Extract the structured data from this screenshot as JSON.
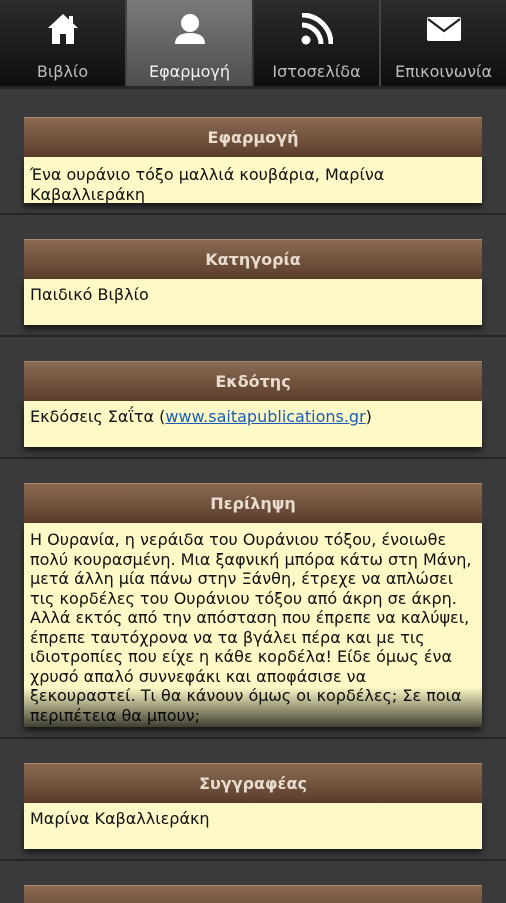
{
  "tabs": [
    {
      "label": "Βιβλίο",
      "icon": "home-icon",
      "active": false
    },
    {
      "label": "Εφαρμογή",
      "icon": "user-icon",
      "active": true
    },
    {
      "label": "Ιστοσελίδα",
      "icon": "rss-icon",
      "active": false
    },
    {
      "label": "Επικοινωνία",
      "icon": "mail-icon",
      "active": false
    }
  ],
  "sections": {
    "app": {
      "title": "Εφαρμογή",
      "value": "Ένα ουράνιο τόξο μαλλιά κουβάρια, Μαρίνα Καβαλλιεράκη"
    },
    "category": {
      "title": "Κατηγορία",
      "value": "Παιδικό Βιβλίο"
    },
    "publisher": {
      "title": "Εκδότης",
      "prefix": "Εκδόσεις Σαΐτα (",
      "link": "www.saitapublications.gr",
      "suffix": ")"
    },
    "summary": {
      "title": "Περίληψη",
      "value": "Η Ουρανία, η νεράιδα του Ουράνιου τόξου, ένοιωθε πολύ κουρασμένη. Μια ξαφνική μπόρα κάτω στη Μάνη, μετά άλλη μία πάνω στην Ξάνθη, έτρεχε να απλώσει τις κορδέλες του Ουράνιου τόξου από άκρη σε άκρη. Αλλά εκτός από την απόσταση που έπρεπε να καλύψει, έπρεπε ταυτόχρονα να τα βγάλει πέρα και με τις ιδιοτροπίες που είχε η κάθε κορδέλα! Είδε όμως ένα χρυσό απαλό συννεφάκι και αποφάσισε να ξεκουραστεί. Τι θα κάνουν όμως οι κορδέλες; Σε ποια περιπέτεια θα μπουν;"
    },
    "author": {
      "title": "Συγγραφέας",
      "value": "Μαρίνα Καβαλλιεράκη"
    }
  },
  "colors": {
    "header_top": "#8a6a53",
    "header_bottom": "#5a3d2a",
    "card_body": "#fdf9c6",
    "background": "#3a3a3a",
    "link": "#1a5db8"
  }
}
